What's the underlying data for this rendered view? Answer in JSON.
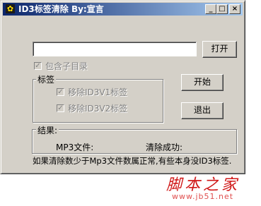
{
  "window": {
    "title": "ID3标签清除   By:宣言",
    "app_icon": "gear-icon",
    "controls": {
      "minimize": "_",
      "maximize": "□",
      "close": "×"
    }
  },
  "path_input": {
    "value": "",
    "placeholder": ""
  },
  "buttons": {
    "open": "打开",
    "start": "开始",
    "exit": "退出"
  },
  "include_subdirs": {
    "label": "包含子目录",
    "checked": true,
    "enabled": false
  },
  "tags_group": {
    "title": "标签",
    "options": [
      {
        "label": "移除ID3V1标签",
        "checked": true,
        "enabled": false
      },
      {
        "label": "移除ID3V2标签",
        "checked": true,
        "enabled": false
      }
    ]
  },
  "results_group": {
    "title": "结果:",
    "mp3_files_label": "MP3文件:",
    "cleared_label": "清除成功:"
  },
  "hint": "如果清除数少于Mp3文件数属正常,有些本身没ID3标签.",
  "watermark": {
    "text": "脚本之家",
    "url": "www.jb51.net",
    "color": "#d01818"
  }
}
